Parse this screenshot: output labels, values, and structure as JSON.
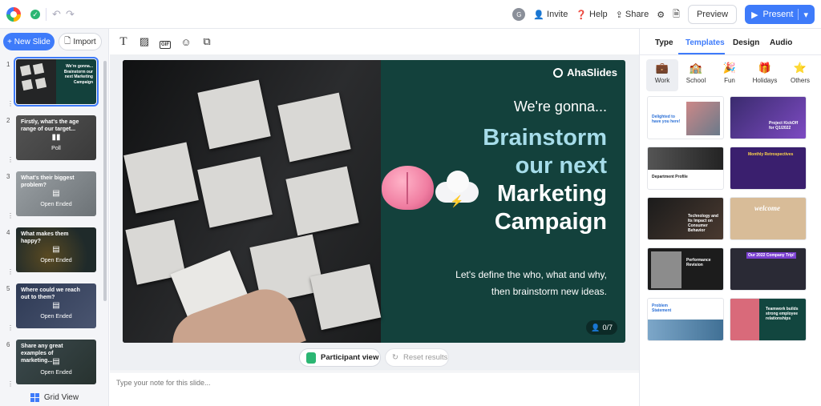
{
  "topbar": {
    "avatar_initial": "G",
    "invite": "Invite",
    "help": "Help",
    "share": "Share",
    "preview": "Preview",
    "present": "Present"
  },
  "left": {
    "new_slide": "+ New Slide",
    "import": "Import",
    "grid_view": "Grid View"
  },
  "slides": [
    {
      "num": "1",
      "question": "We're gonna... Brainstorm our next Marketing Campaign",
      "type": ""
    },
    {
      "num": "2",
      "question": "Firstly, what's the age range of our target...",
      "type": "Poll"
    },
    {
      "num": "3",
      "question": "What's their biggest problem?",
      "type": "Open Ended"
    },
    {
      "num": "4",
      "question": "What makes them happy?",
      "type": "Open Ended"
    },
    {
      "num": "5",
      "question": "Where could we reach out to them?",
      "type": "Open Ended"
    },
    {
      "num": "6",
      "question": "Share any great examples of marketing...",
      "type": "Open Ended"
    }
  ],
  "slide": {
    "brand": "AhaSlides",
    "line1": "We're gonna...",
    "line2a": "Brainstorm",
    "line2b": "our next",
    "line3a": "Marketing",
    "line3b": "Campaign",
    "sub1": "Let's define the who, what and why,",
    "sub2": "then brainstorm new ideas.",
    "responses": "0/7"
  },
  "bottom": {
    "participant_view": "Participant view",
    "reset_results": "Reset results",
    "note_placeholder": "Type your note for this slide..."
  },
  "right": {
    "tabs": [
      "Type",
      "Templates",
      "Design",
      "Audio"
    ],
    "categories": [
      {
        "label": "Work",
        "icon": "briefcase-icon"
      },
      {
        "label": "School",
        "icon": "school-icon"
      },
      {
        "label": "Fun",
        "icon": "party-icon"
      },
      {
        "label": "Holidays",
        "icon": "gift-icon"
      },
      {
        "label": "Others",
        "icon": "star-icon"
      }
    ],
    "templates": [
      {
        "title": "Delighted to have you here!"
      },
      {
        "title": "Project KickOff for Q1/2022"
      },
      {
        "title": "Department Profile"
      },
      {
        "title": "Monthly Retrospectives"
      },
      {
        "title": "Technology and Its Impact on Consumer Behavior"
      },
      {
        "title": "welcome"
      },
      {
        "title": "Performance Revision"
      },
      {
        "title": "Our 2022 Company Trip!"
      },
      {
        "title": "Problem Statement"
      },
      {
        "title": "Teamwork builds strong employee relationships"
      }
    ]
  },
  "colors": {
    "accent": "#3e7bfa",
    "slide_bg": "#13413c",
    "highlight_text": "#a6ddea"
  }
}
